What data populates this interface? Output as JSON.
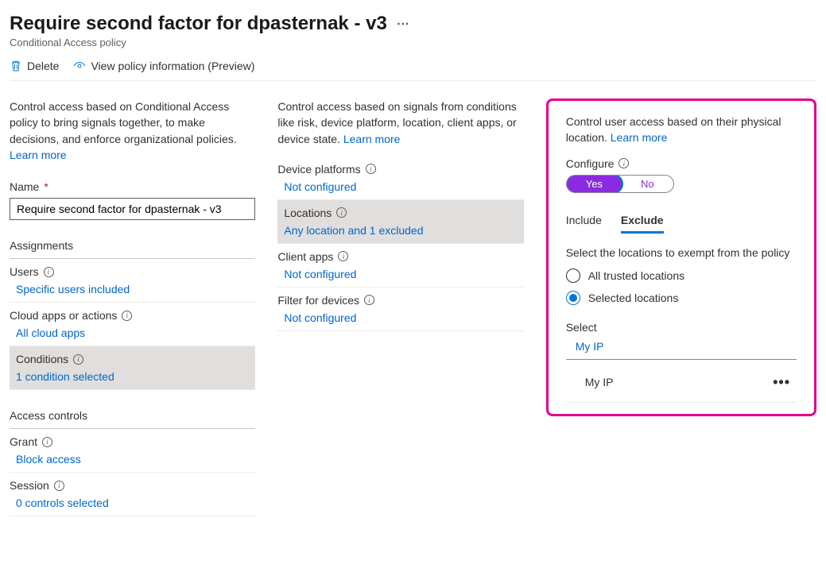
{
  "header": {
    "title": "Require second factor for dpasternak - v3",
    "subtitle": "Conditional Access policy"
  },
  "actions": {
    "delete": "Delete",
    "viewInfo": "View policy information (Preview)"
  },
  "col1": {
    "intro": "Control access based on Conditional Access policy to bring signals together, to make decisions, and enforce organizational policies. ",
    "learnMore": "Learn more",
    "nameLabel": "Name",
    "nameValue": "Require second factor for dpasternak - v3",
    "assignmentsHeader": "Assignments",
    "users": {
      "title": "Users",
      "value": "Specific users included"
    },
    "cloud": {
      "title": "Cloud apps or actions",
      "value": "All cloud apps"
    },
    "conditions": {
      "title": "Conditions",
      "value": "1 condition selected"
    },
    "accessHeader": "Access controls",
    "grant": {
      "title": "Grant",
      "value": "Block access"
    },
    "session": {
      "title": "Session",
      "value": "0 controls selected"
    }
  },
  "col2": {
    "intro": "Control access based on signals from conditions like risk, device platform, location, client apps, or device state. ",
    "learnMore": "Learn more",
    "device": {
      "title": "Device platforms",
      "value": "Not configured"
    },
    "locations": {
      "title": "Locations",
      "value": "Any location and 1 excluded"
    },
    "clientApps": {
      "title": "Client apps",
      "value": "Not configured"
    },
    "filter": {
      "title": "Filter for devices",
      "value": "Not configured"
    }
  },
  "col3": {
    "intro": "Control user access based on their physical location. ",
    "learnMore": "Learn more",
    "configureLabel": "Configure",
    "toggleYes": "Yes",
    "toggleNo": "No",
    "tabInclude": "Include",
    "tabExclude": "Exclude",
    "exemptText": "Select the locations to exempt from the policy",
    "radioTrusted": "All trusted locations",
    "radioSelected": "Selected locations",
    "selectLabel": "Select",
    "selectValue": "My IP",
    "selectedItem": "My IP"
  }
}
